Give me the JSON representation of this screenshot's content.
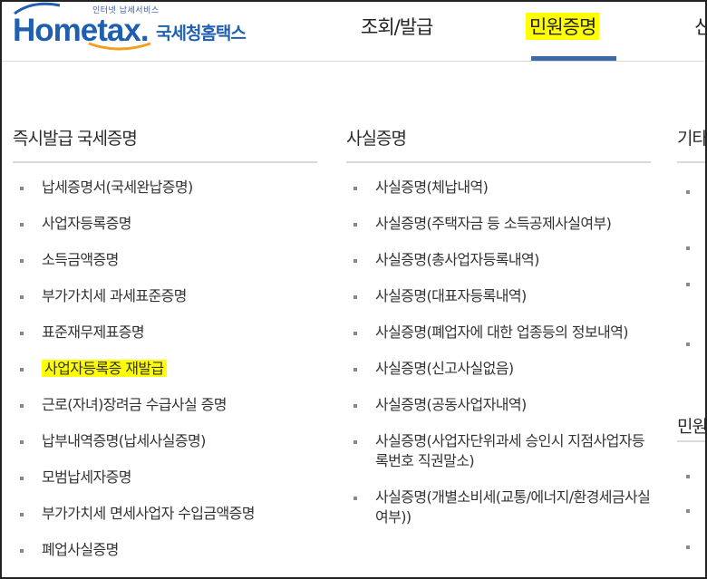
{
  "logo": {
    "tagline": "인터넷 납세서비스",
    "brand_main": "Hometax.",
    "brand_kr": "국세청홈택스"
  },
  "nav": {
    "lookup": "조회/발급",
    "civil": "민원증명",
    "next_partial": "신"
  },
  "columns": {
    "instant": {
      "title": "즉시발급 국세증명",
      "items": [
        "납세증명서(국세완납증명)",
        "사업자등록증명",
        "소득금액증명",
        "부가가치세 과세표준증명",
        "표준재무제표증명",
        "사업자등록증 재발급",
        "근로(자녀)장려금 수급사실 증명",
        "납부내역증명(납세사실증명)",
        "모범납세자증명",
        "부가가치세 면세사업자 수입금액증명",
        "폐업사실증명"
      ],
      "highlight_index": 5
    },
    "fact": {
      "title": "사실증명",
      "items": [
        "사실증명(체납내역)",
        "사실증명(주택자금 등 소득공제사실여부)",
        "사실증명(총사업자등록내역)",
        "사실증명(대표자등록내역)",
        "사실증명(폐업자에 대한 업종등의 정보내역)",
        "사실증명(신고사실없음)",
        "사실증명(공동사업자내역)",
        "사실증명(사업자단위과세 승인시 지점사업자등록번호 직권말소)",
        "사실증명(개별소비세(교통/에너지/환경세금사실여부))"
      ]
    },
    "other": {
      "title_partial": "기타",
      "title2_partial": "민원"
    }
  },
  "colors": {
    "brand_blue": "#1f5fb0",
    "highlight": "#ffff00",
    "nav_underline": "#3b6aa8"
  }
}
